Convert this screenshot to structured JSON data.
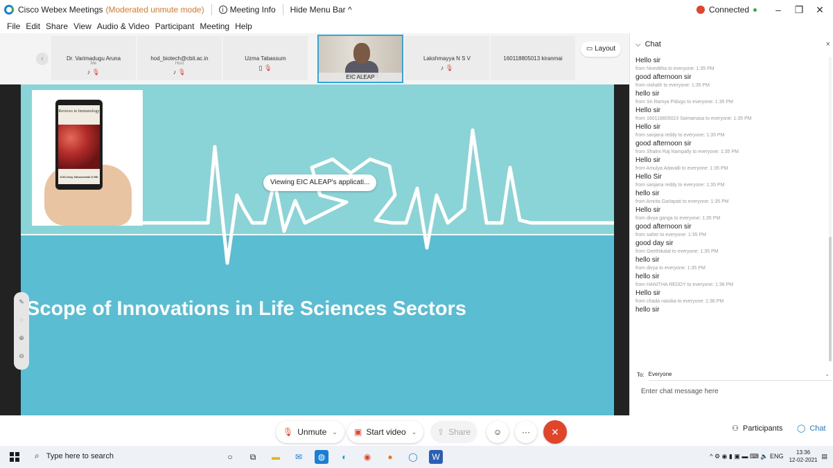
{
  "window": {
    "app_title": "Cisco Webex Meetings",
    "mode": "(Moderated unmute mode)",
    "meeting_info": "Meeting Info",
    "hide_menu": "Hide Menu Bar ^",
    "status": "Connected",
    "minimize": "–",
    "maximize": "❐",
    "close": "✕"
  },
  "menu": [
    "File",
    "Edit",
    "Share",
    "View",
    "Audio & Video",
    "Participant",
    "Meeting",
    "Help"
  ],
  "participants_strip": {
    "prev": "‹",
    "tiles": [
      {
        "name": "Dr. Varimadugu Aruna",
        "sub": "Me"
      },
      {
        "name": "hod_biotech@cbit.ac.in",
        "sub": "Host"
      },
      {
        "name": "Uzma Tabassum",
        "sub": ""
      },
      {
        "name": "Lakshmayya N S V",
        "sub": ""
      },
      {
        "name": "160118805013 kiranmai",
        "sub": ""
      }
    ],
    "video_tile_name": "EIC ALEAP",
    "layout_label": "Layout"
  },
  "share": {
    "viewing_label": "Viewing EIC ALEAP's applicati...",
    "slide_title": "Scope of Innovations in Life Sciences Sectors",
    "book_title": "Reviews in Immunology",
    "book_author": "S.M.Liboy  Zahoorulhak S MD"
  },
  "chat": {
    "title": "Chat",
    "close": "×",
    "messages": [
      {
        "from": "",
        "text": "Hello sir"
      },
      {
        "from": "from Niveditha to everyone:   1:35 PM",
        "text": "good afternoon sir"
      },
      {
        "from": "from nishath to everyone:   1:35 PM",
        "text": "hello sir"
      },
      {
        "from": "from Sri Ramya Pidugu to everyone:   1:35 PM",
        "text": "Hello sir"
      },
      {
        "from": "from 160118805023 Saimanasa to everyone:   1:35 PM",
        "text": "Hello sir"
      },
      {
        "from": "from sanjana reddy to everyone:   1:35 PM",
        "text": "good afternoon sir"
      },
      {
        "from": "from Shalini Raj Nampally to everyone:   1:35 PM",
        "text": "Hello sir"
      },
      {
        "from": "from Amulya Adavalli to everyone:   1:35 PM",
        "text": "Hello Sir"
      },
      {
        "from": "from sanjana reddy to everyone:   1:35 PM",
        "text": "hello sir"
      },
      {
        "from": "from Amrita Garlapati to everyone:   1:35 PM",
        "text": "Hello sir"
      },
      {
        "from": "from divya ganga to everyone:   1:35 PM",
        "text": "good afternoon sir"
      },
      {
        "from": "from saher to everyone:   1:35 PM",
        "text": "good day sir"
      },
      {
        "from": "from Geethikalal to everyone:   1:35 PM",
        "text": "hello sir"
      },
      {
        "from": "from divya to everyone:   1:35 PM",
        "text": "hello sir"
      },
      {
        "from": "from HANITHA REDDY to everyone:   1:36 PM",
        "text": "Hello sir"
      },
      {
        "from": "from chada naisika to everyone:   1:36 PM",
        "text": "hello sir"
      }
    ],
    "to_label": "To:",
    "to_value": "Everyone",
    "input_placeholder": "Enter chat message here"
  },
  "controls": {
    "unmute": "Unmute",
    "start_video": "Start video",
    "share": "Share",
    "participants": "Participants",
    "chat": "Chat"
  },
  "taskbar": {
    "search": "Type here to search",
    "lang": "ENG",
    "time": "13:36",
    "date": "12-02-2021"
  },
  "colors": {
    "accent": "#1a7fd4",
    "alert": "#e0452a",
    "slide_top": "#8ad3d6",
    "slide_bottom": "#5bbdd1"
  }
}
